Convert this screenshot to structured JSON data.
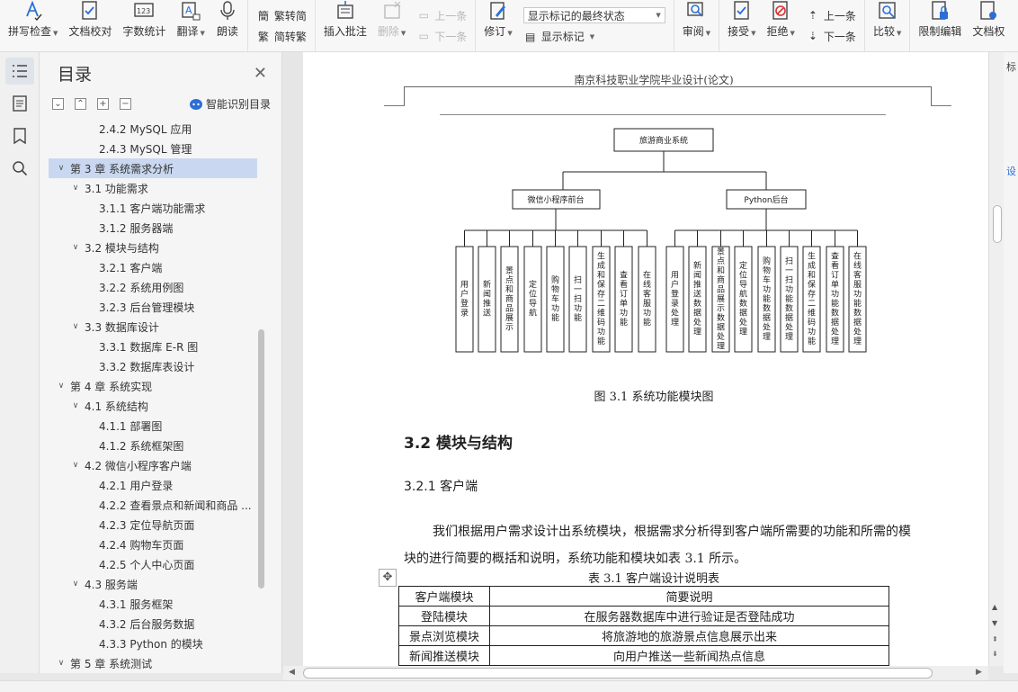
{
  "ribbon": {
    "spell_check": "拼写检查",
    "doc_proof": "文档校对",
    "word_count": "字数统计",
    "translate": "翻译",
    "read_aloud": "朗读",
    "trad_convert": "繁转简",
    "simp_convert": "简转繁",
    "insert_comment": "插入批注",
    "delete": "删除",
    "prev_comment": "上一条",
    "next_comment": "下一条",
    "display_select": "显示标记的最终状态",
    "revise": "修订",
    "show_markup": "显示标记",
    "review": "审阅",
    "accept": "接受",
    "reject": "拒绝",
    "prev_change": "上一条",
    "next_change": "下一条",
    "compare": "比较",
    "restrict_edit": "限制编辑",
    "doc_perm": "文档权"
  },
  "toc": {
    "title": "目录",
    "smart_toc": "智能识别目录",
    "items": [
      {
        "label": "2.4.2 MySQL 应用",
        "level": 3
      },
      {
        "label": "2.4.3 MySQL 管理",
        "level": 3
      },
      {
        "label": "第 3 章  系统需求分析",
        "level": 1,
        "selected": true,
        "expanded": true
      },
      {
        "label": "3.1 功能需求",
        "level": 2,
        "expanded": true
      },
      {
        "label": "3.1.1  客户端功能需求",
        "level": 3
      },
      {
        "label": "3.1.2  服务器端",
        "level": 3
      },
      {
        "label": "3.2  模块与结构",
        "level": 2,
        "expanded": true
      },
      {
        "label": "3.2.1  客户端",
        "level": 3
      },
      {
        "label": "3.2.2  系统用例图",
        "level": 3
      },
      {
        "label": "3.2.3  后台管理模块",
        "level": 3
      },
      {
        "label": "3.3  数据库设计",
        "level": 2,
        "expanded": true
      },
      {
        "label": "3.3.1 数据库 E-R 图",
        "level": 3
      },
      {
        "label": "3.3.2 数据库表设计",
        "level": 3
      },
      {
        "label": "第 4 章  系统实现",
        "level": 1,
        "expanded": true
      },
      {
        "label": "4.1  系统结构",
        "level": 2,
        "expanded": true
      },
      {
        "label": "4.1.1  部署图",
        "level": 3
      },
      {
        "label": "4.1.2  系统框架图",
        "level": 3
      },
      {
        "label": "4.2  微信小程序客户端",
        "level": 2,
        "expanded": true
      },
      {
        "label": "4.2.1  用户登录",
        "level": 3
      },
      {
        "label": "4.2.2  查看景点和新闻和商品 ...",
        "level": 3
      },
      {
        "label": "4.2.3  定位导航页面",
        "level": 3
      },
      {
        "label": "4.2.4  购物车页面",
        "level": 3
      },
      {
        "label": "4.2.5  个人中心页面",
        "level": 3
      },
      {
        "label": "4.3  服务端",
        "level": 2,
        "expanded": true
      },
      {
        "label": "4.3.1  服务框架",
        "level": 3
      },
      {
        "label": "4.3.2  后台服务数据",
        "level": 3
      },
      {
        "label": "4.3.3 Python 的模块",
        "level": 3
      },
      {
        "label": "第 5 章  系统测试",
        "level": 1,
        "expanded": true
      }
    ]
  },
  "doc": {
    "header": "南京科技职业学院毕业设计(论文)",
    "diagram": {
      "root": "旅游商业系统",
      "left_branch": "微信小程序前台",
      "right_branch": "Python后台",
      "left_leaves": [
        "用户登录",
        "新闻推送",
        "景点和商品展示",
        "定位导航",
        "购物车功能",
        "扫一扫功能",
        "生成和保存二维码功能",
        "查看订单功能",
        "在线客服功能"
      ],
      "right_leaves": [
        "用户登录处理",
        "新闻推送数据处理",
        "景点和商品展示数据处理",
        "定位导航数据处理",
        "购物车功能数据处理",
        "扫一扫功能数据处理",
        "生成和保存二维码功能",
        "查看订单功能数据处理",
        "在线客服功能数据处理"
      ]
    },
    "figure_caption": "图 3.1 系统功能模块图",
    "h2": "3.2  模块与结构",
    "h3": "3.2.1  客户端",
    "paragraph": "我们根据用户需求设计出系统模块，根据需求分析得到客户端所需要的功能和所需的模块的进行简要的概括和说明，系统功能和模块如表 3.1 所示。",
    "table_caption": "表 3.1  客户端设计说明表",
    "table_rows": [
      [
        "客户端模块",
        "简要说明"
      ],
      [
        "登陆模块",
        "在服务器数据库中进行验证是否登陆成功"
      ],
      [
        "景点浏览模块",
        "将旅游地的旅游景点信息展示出来"
      ],
      [
        "新闻推送模块",
        "向用户推送一些新闻热点信息"
      ]
    ]
  },
  "side_rail": [
    "标",
    "设"
  ],
  "colors": {
    "toc_selected": "#c9d8f0",
    "accent": "#2b6fd6"
  }
}
